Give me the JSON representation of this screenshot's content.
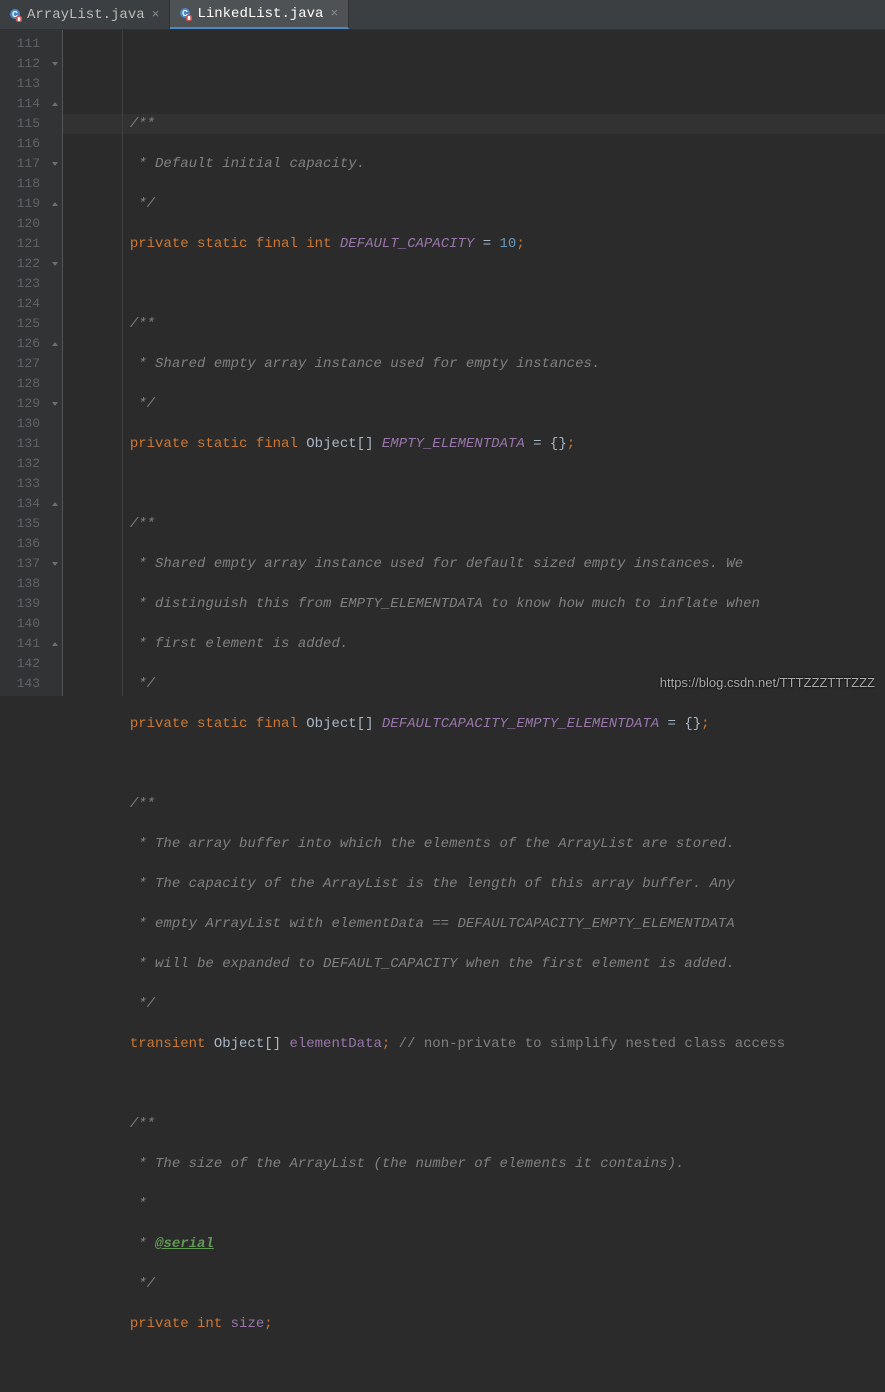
{
  "tabs": [
    {
      "label": "ArrayList.java",
      "active": false
    },
    {
      "label": "LinkedList.java",
      "active": true
    }
  ],
  "watermark": "https://blog.csdn.net/TTTZZZTTTZZZ",
  "lines": {
    "start": 111,
    "end": 143
  },
  "code": {
    "l112_a": "/**",
    "l113_a": " * Default initial capacity.",
    "l114_a": " */",
    "l115_kw1": "private ",
    "l115_kw2": "static ",
    "l115_kw3": "final ",
    "l115_kw4": "int ",
    "l115_const": "DEFAULT_CAPACITY",
    "l115_eq": " = ",
    "l115_num": "10",
    "l115_semi": ";",
    "l117_a": "/**",
    "l118_a": " * Shared empty array instance used for empty instances.",
    "l119_a": " */",
    "l120_kw1": "private ",
    "l120_kw2": "static ",
    "l120_kw3": "final ",
    "l120_type": "Object[] ",
    "l120_const": "EMPTY_ELEMENTDATA",
    "l120_eq": " = {}",
    "l120_semi": ";",
    "l122_a": "/**",
    "l123_a": " * Shared empty array instance used for default sized empty instances. We",
    "l124_a": " * distinguish this from EMPTY_ELEMENTDATA to know how much to inflate when",
    "l125_a": " * first element is added.",
    "l126_a": " */",
    "l127_kw1": "private ",
    "l127_kw2": "static ",
    "l127_kw3": "final ",
    "l127_type": "Object[] ",
    "l127_const": "DEFAULTCAPACITY_EMPTY_ELEMENTDATA",
    "l127_eq": " = {}",
    "l127_semi": ";",
    "l129_a": "/**",
    "l130_a": " * The array buffer into which the elements of the ArrayList are stored.",
    "l131_a": " * The capacity of the ArrayList is the length of this array buffer. Any",
    "l132_a": " * empty ArrayList with elementData == DEFAULTCAPACITY_EMPTY_ELEMENTDATA",
    "l133_a": " * will be expanded to DEFAULT_CAPACITY when the first element is added.",
    "l134_a": " */",
    "l135_kw1": "transient ",
    "l135_type": "Object[] ",
    "l135_field": "elementData",
    "l135_semi": ";",
    "l135_comment": " // non-private to simplify nested class access",
    "l137_a": "/**",
    "l138_a": " * The size of the ArrayList (the number of elements it contains).",
    "l139_a": " *",
    "l140_a": " * ",
    "l140_tag": "@serial",
    "l141_a": " */",
    "l142_kw1": "private ",
    "l142_kw2": "int ",
    "l142_field": "size",
    "l142_semi": ";"
  }
}
